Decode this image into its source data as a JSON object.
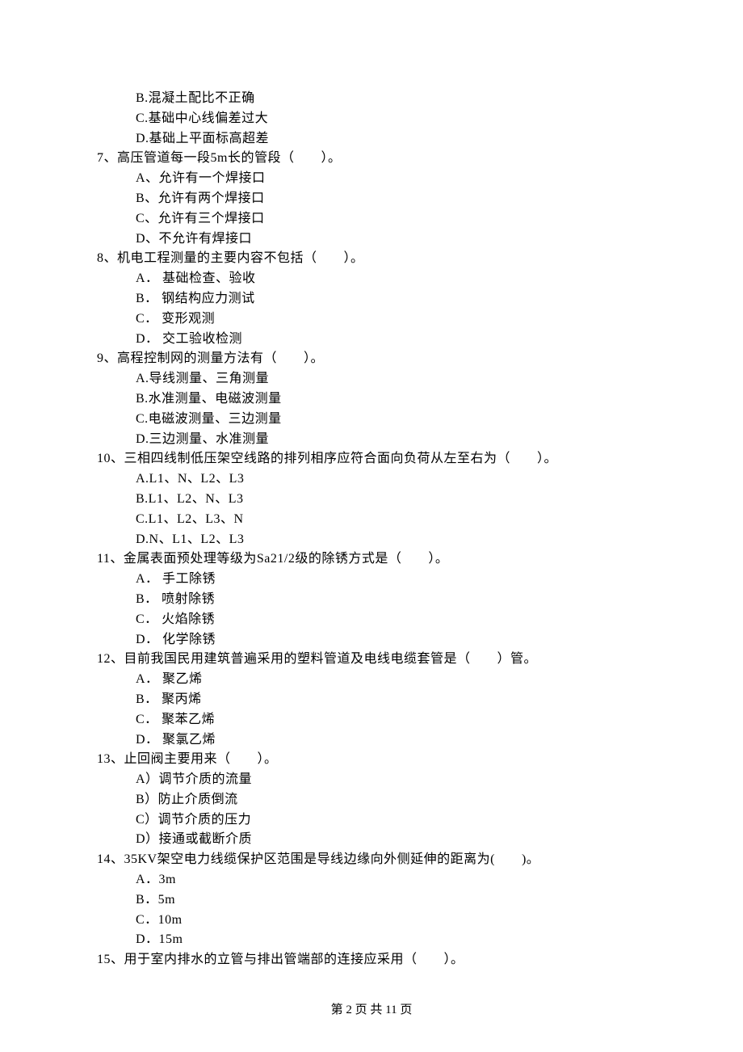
{
  "q6": {
    "optB": "B.混凝土配比不正确",
    "optC": "C.基础中心线偏差过大",
    "optD": "D.基础上平面标高超差"
  },
  "q7": {
    "stem": "7、高压管道每一段5m长的管段（　　）。",
    "optA": "A、允许有一个焊接口",
    "optB": "B、允许有两个焊接口",
    "optC": "C、允许有三个焊接口",
    "optD": "D、不允许有焊接口"
  },
  "q8": {
    "stem": "8、机电工程测量的主要内容不包括（　　）。",
    "optA": "A． 基础检查、验收",
    "optB": "B． 钢结构应力测试",
    "optC": "C． 变形观测",
    "optD": "D． 交工验收检测"
  },
  "q9": {
    "stem": "9、高程控制网的测量方法有（　　）。",
    "optA": "A.导线测量、三角测量",
    "optB": "B.水准测量、电磁波测量",
    "optC": "C.电磁波测量、三边测量",
    "optD": "D.三边测量、水准测量"
  },
  "q10": {
    "stem": "10、三相四线制低压架空线路的排列相序应符合面向负荷从左至右为（　　）。",
    "optA": "A.L1、N、L2、L3",
    "optB": "B.L1、L2、N、L3",
    "optC": "C.L1、L2、L3、N",
    "optD": "D.N、L1、L2、L3"
  },
  "q11": {
    "stem": "11、金属表面预处理等级为Sa21/2级的除锈方式是（　　）。",
    "optA": "A． 手工除锈",
    "optB": "B． 喷射除锈",
    "optC": "C． 火焰除锈",
    "optD": "D． 化学除锈"
  },
  "q12": {
    "stem": "12、目前我国民用建筑普遍采用的塑料管道及电线电缆套管是（　　）管。",
    "optA": "A． 聚乙烯",
    "optB": "B． 聚丙烯",
    "optC": "C． 聚苯乙烯",
    "optD": "D． 聚氯乙烯"
  },
  "q13": {
    "stem": "13、止回阀主要用来（　　）。",
    "optA": "A）调节介质的流量",
    "optB": "B）防止介质倒流",
    "optC": "C）调节介质的压力",
    "optD": "D）接通或截断介质"
  },
  "q14": {
    "stem": "14、35KV架空电力线缆保护区范围是导线边缘向外侧延伸的距离为(　　)。",
    "optA": "A．3m",
    "optB": "B．5m",
    "optC": "C．10m",
    "optD": "D．15m"
  },
  "q15": {
    "stem": "15、用于室内排水的立管与排出管端部的连接应采用（　　）。"
  },
  "footer": "第 2 页 共 11 页"
}
